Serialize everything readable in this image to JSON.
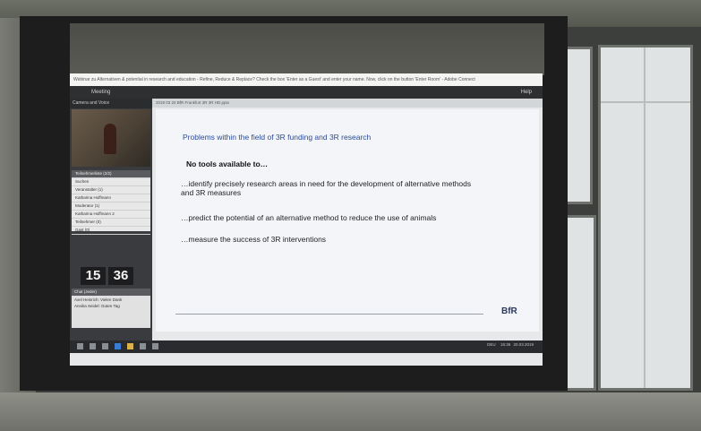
{
  "meeting": {
    "window_title": "Webinar zu Alternativen & potential in research and education - Refine, Reduce & Replace? Check the box 'Enter as a Guest' and enter your name. Now, click on the button 'Enter Room' - Adobe Connect",
    "menu_help": "Help",
    "app_tab": "Meeting",
    "pod_camera": "Camera and Voice",
    "pod_slide": "2019 03 20 BfR Frankfurt 3R 3R HD.pptx",
    "attendee_count_label": "Teilnehmerliste (2/2)",
    "attendee_rows": [
      "Suchen",
      "Veranstalter (1)",
      "Katharina Hoffmann",
      "Moderator (1)",
      "Katharina Hoffmann 2",
      "Teilnehmer (0)",
      "Gast (0)"
    ],
    "clock": {
      "hours": "15",
      "minutes": "36"
    },
    "chat_label": "Chat (Jeder)",
    "chat_lines": [
      "Axel Heinrich: Vielen Dank",
      "Annika Seidel: Guten Tag"
    ],
    "tray_time": "15:36",
    "tray_date": "20.03.2019",
    "tray_lang": "DEU"
  },
  "slide": {
    "title": "Problems within the field of 3R funding and 3R research",
    "bold_line": "No tools available to…",
    "bullets": [
      "…identify precisely research areas in need for the development of alternative methods and 3R measures",
      "…predict the potential of an alternative method to reduce the use of animals",
      "…measure the success of 3R interventions"
    ],
    "logo": "BfR"
  }
}
